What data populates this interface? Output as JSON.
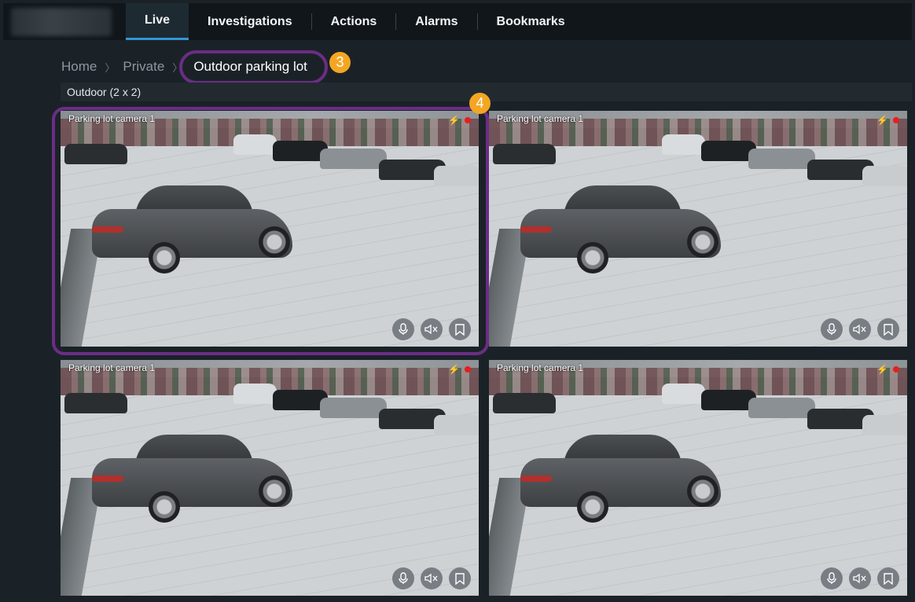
{
  "nav": {
    "tabs": [
      {
        "label": "Live",
        "active": true
      },
      {
        "label": "Investigations"
      },
      {
        "label": "Actions"
      },
      {
        "label": "Alarms"
      },
      {
        "label": "Bookmarks"
      }
    ]
  },
  "breadcrumb": {
    "items": [
      "Home",
      "Private",
      "Outdoor parking lot"
    ]
  },
  "callouts": {
    "breadcrumb": "3",
    "tile": "4"
  },
  "view": {
    "title": "Outdoor (2 x 2)"
  },
  "tiles": [
    {
      "camera": "Parking lot camera 1"
    },
    {
      "camera": "Parking lot camera 1"
    },
    {
      "camera": "Parking lot camera 1"
    },
    {
      "camera": "Parking lot camera 1"
    }
  ],
  "icons": {
    "microphone": "microphone-icon",
    "speaker_muted": "speaker-muted-icon",
    "bookmark": "bookmark-icon",
    "motion": "motion-icon",
    "recording": "recording-dot-icon"
  },
  "colors": {
    "accent": "#2f98d6",
    "highlight": "#6b2d86",
    "badge": "#f4a623",
    "recording": "#e81e1e"
  }
}
